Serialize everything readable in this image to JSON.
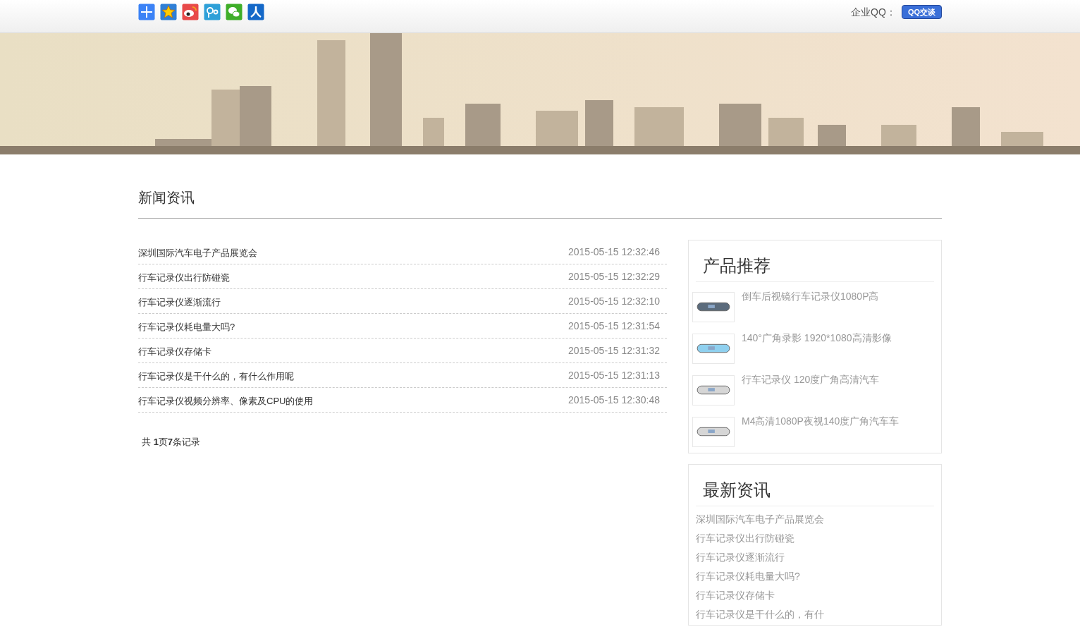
{
  "share_icons": [
    {
      "kind": "plus",
      "color": "#3b82f6"
    },
    {
      "kind": "star",
      "color": "#2f7fd6"
    },
    {
      "kind": "weibo",
      "color": "#e84a4a"
    },
    {
      "kind": "tqq",
      "color": "#2ea0d8"
    },
    {
      "kind": "wechat",
      "color": "#3fae29"
    },
    {
      "kind": "renren",
      "color": "#1468c8"
    }
  ],
  "qq": {
    "label": "企业QQ：",
    "button": "QQ交谈"
  },
  "section_title": "新闻资讯",
  "news": [
    {
      "title": "深圳国际汽车电子产品展览会",
      "date": "2015-05-15 12:32:46"
    },
    {
      "title": "行车记录仪出行防碰瓷",
      "date": "2015-05-15 12:32:29"
    },
    {
      "title": "行车记录仪逐渐流行",
      "date": "2015-05-15 12:32:10"
    },
    {
      "title": "行车记录仪耗电量大吗?",
      "date": "2015-05-15 12:31:54"
    },
    {
      "title": "行车记录仪存储卡",
      "date": "2015-05-15 12:31:32"
    },
    {
      "title": "行车记录仪是干什么的，有什么作用呢",
      "date": "2015-05-15 12:31:13"
    },
    {
      "title": "行车记录仪视频分辨率、像素及CPU的使用",
      "date": "2015-05-15 12:30:48"
    }
  ],
  "pagination": "共 **1**页**7**条记录",
  "products": {
    "title": "产品推荐",
    "items": [
      {
        "name": "倒车后视镜行车记录仪1080P高",
        "kind": "dark"
      },
      {
        "name": "140°广角录影 1920*1080高清影像",
        "kind": "blue"
      },
      {
        "name": "行车记录仪 120度广角高清汽车",
        "kind": "silver"
      },
      {
        "name": "M4高清1080P夜视140度广角汽车车",
        "kind": "silver"
      }
    ]
  },
  "latest": {
    "title": "最新资讯",
    "items": [
      "深圳国际汽车电子产品展览会",
      "行车记录仪出行防碰瓷",
      "行车记录仪逐渐流行",
      "行车记录仪耗电量大吗?",
      "行车记录仪存储卡",
      "行车记录仪是干什么的，有什"
    ]
  }
}
